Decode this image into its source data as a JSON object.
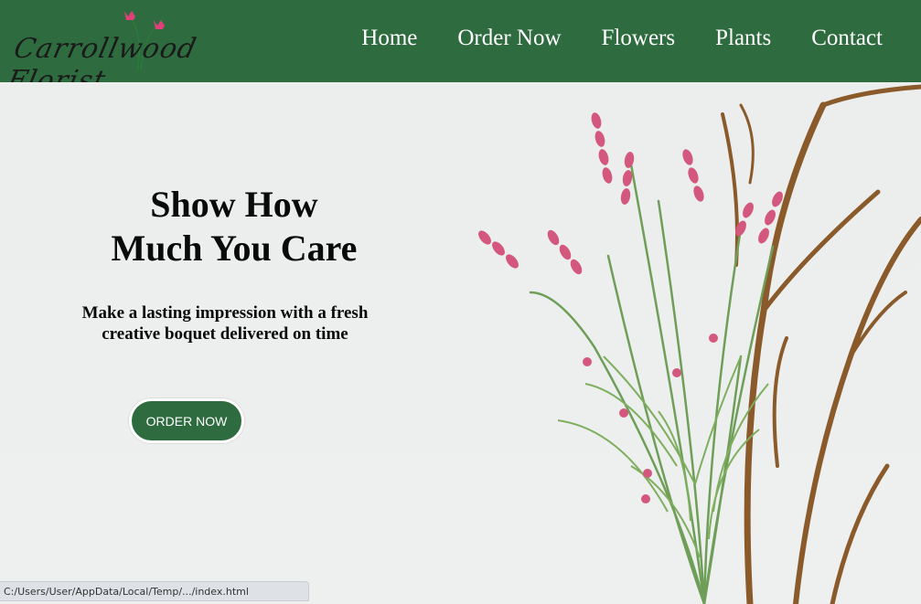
{
  "brand": {
    "logo_text": "Carrollwood Florist"
  },
  "nav": {
    "items": [
      {
        "label": "Home"
      },
      {
        "label": "Order Now"
      },
      {
        "label": "Flowers"
      },
      {
        "label": "Plants"
      },
      {
        "label": "Contact"
      }
    ]
  },
  "hero": {
    "headline_line1": "Show How",
    "headline_line2": "Much You Care",
    "subhead": "Make a lasting impression with a fresh creative boquet delivered on time",
    "cta_label": "ORDER NOW"
  },
  "status_bar": {
    "url": "C:/Users/User/AppData/Local/Temp/.../index.html"
  },
  "colors": {
    "brand_green": "#2e6c40",
    "flower_pink": "#d4577e",
    "background": "#eceeed"
  },
  "icons": {
    "logo_flower": "tulip-icon"
  }
}
